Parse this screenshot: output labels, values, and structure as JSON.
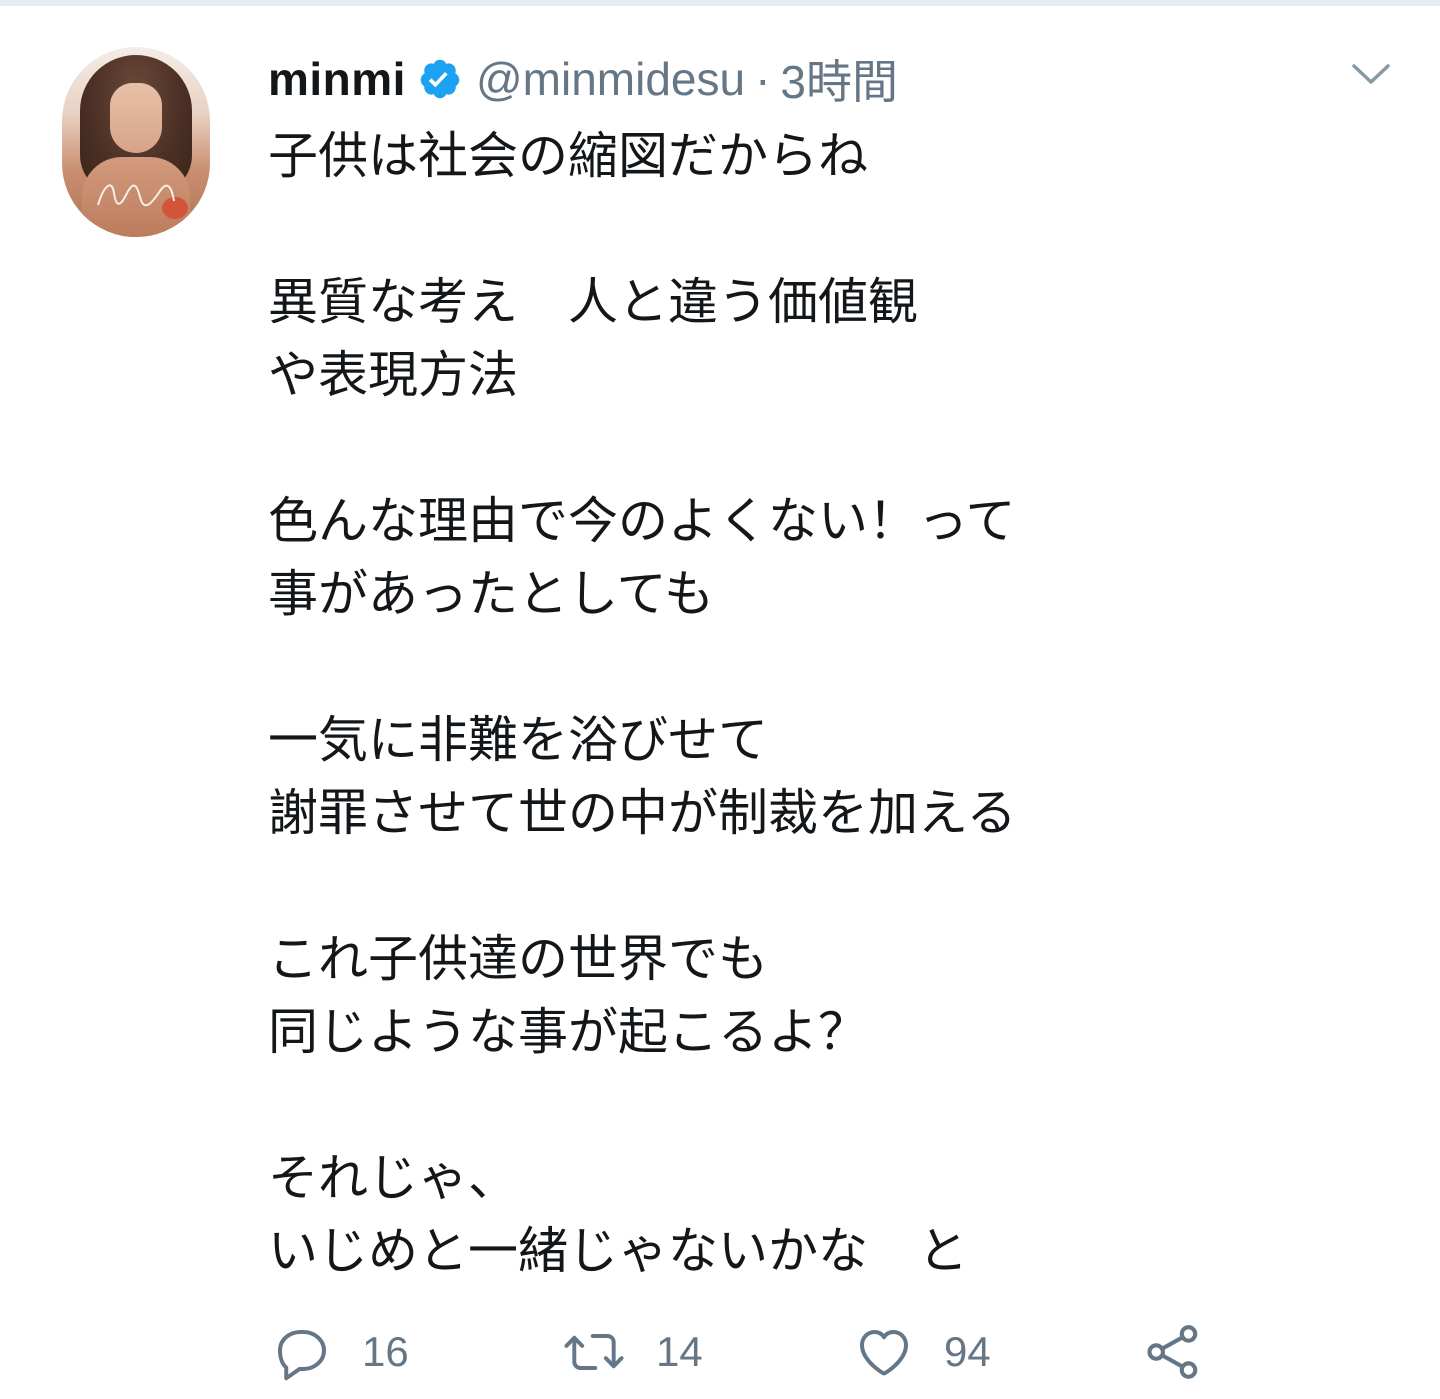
{
  "tweet": {
    "author_name": "minmi",
    "handle": "@minmidesu",
    "separator": "·",
    "time": "3時間",
    "lines": [
      "子供は社会の縮図だからね",
      "",
      "異質な考え　人と違う価値観",
      "や表現方法",
      "",
      "色んな理由で今のよくない！って",
      "事があったとしても",
      "",
      "一気に非難を浴びせて",
      "謝罪させて世の中が制裁を加える",
      "",
      "これ子供達の世界でも",
      "同じような事が起こるよ？",
      "",
      "それじゃ、",
      "いじめと一緒じゃないかな　と"
    ]
  },
  "actions": {
    "reply_count": "16",
    "retweet_count": "14",
    "like_count": "94"
  },
  "icons": {
    "verified": "verified-badge-icon",
    "menu": "chevron-down-icon",
    "reply": "reply-icon",
    "retweet": "retweet-icon",
    "like": "heart-icon",
    "share": "share-icon"
  },
  "colors": {
    "text": "#14171a",
    "secondary": "#657786",
    "verified": "#1da1f2",
    "divider": "#e6ecf0"
  }
}
